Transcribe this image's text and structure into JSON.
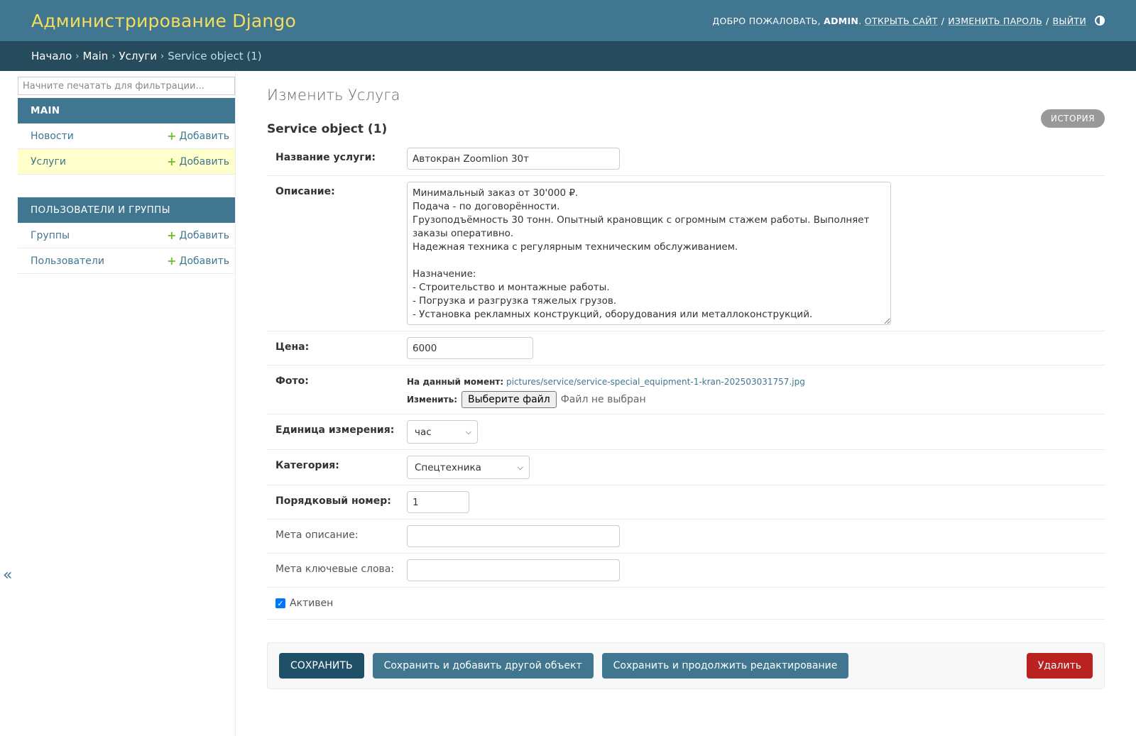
{
  "header": {
    "brand": "Администрирование Django",
    "welcome": "Добро пожаловать,",
    "username": "admin",
    "view_site": "Открыть сайт",
    "change_password": "Изменить пароль",
    "logout": "Выйти",
    "sep": "/"
  },
  "breadcrumbs": {
    "home": "Начало",
    "app": "Main",
    "model": "Услуги",
    "current": "Service object (1)",
    "chev": "›"
  },
  "sidebar": {
    "filter_placeholder": "Начните печатать для фильтрации...",
    "modules": [
      {
        "caption": "Main",
        "models": [
          {
            "label": "Новости",
            "add": "Добавить"
          },
          {
            "label": "Услуги",
            "add": "Добавить"
          }
        ]
      },
      {
        "caption": "Пользователи и группы",
        "models": [
          {
            "label": "Группы",
            "add": "Добавить"
          },
          {
            "label": "Пользователи",
            "add": "Добавить"
          }
        ]
      }
    ],
    "collapse": "«"
  },
  "content": {
    "title": "Изменить Услуга",
    "history": "История",
    "object_title": "Service object (1)",
    "fields": {
      "name": {
        "label": "Название услуги:",
        "value": "Автокран Zoomlion 30т"
      },
      "description": {
        "label": "Описание:",
        "value": "Минимальный заказ от 30'000 ₽.\nПодача - по договорённости.\nГрузоподъёмность 30 тонн. Опытный крановщик с огромным стажем работы. Выполняет заказы оперативно.\nНадежная техника с регулярным техническим обслуживанием.\n\nНазначение:\n- Строительство и монтажные работы.\n- Погрузка и разгрузка тяжелых грузов.\n- Установка рекламных конструкций, оборудования или металлоконструкций."
      },
      "price": {
        "label": "Цена:",
        "value": "6000"
      },
      "photo": {
        "label": "Фото:",
        "currently": "На данный момент:",
        "file": "pictures/service/service-special_equipment-1-kran-202503031757.jpg",
        "change": "Изменить:",
        "choose": "Выберите файл",
        "no_file": "Файл не выбран"
      },
      "unit": {
        "label": "Единица измерения:",
        "value": "час"
      },
      "category": {
        "label": "Категория:",
        "value": "Спецтехника"
      },
      "order": {
        "label": "Порядковый номер:",
        "value": "1"
      },
      "meta_description": {
        "label": "Мета описание:",
        "value": ""
      },
      "meta_keywords": {
        "label": "Мета ключевые слова:",
        "value": ""
      },
      "active": {
        "label": "Активен",
        "checked": true
      }
    },
    "buttons": {
      "save": "Сохранить",
      "save_add": "Сохранить и добавить другой объект",
      "save_continue": "Сохранить и продолжить редактирование",
      "delete": "Удалить"
    }
  }
}
